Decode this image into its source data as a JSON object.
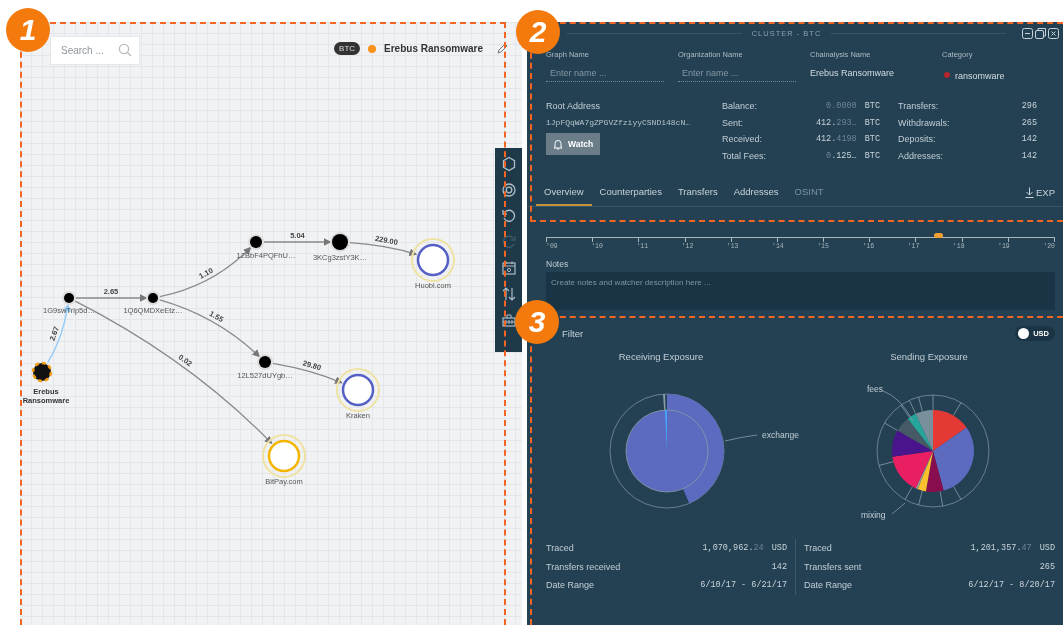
{
  "annotations": [
    {
      "number": "1"
    },
    {
      "number": "2"
    },
    {
      "number": "3"
    }
  ],
  "graph": {
    "search": {
      "placeholder": "Search ..."
    },
    "currency": "BTC",
    "entity_name": "Erebus Ransomware",
    "nodes": [
      {
        "label": "Erebus Ransomware",
        "kind": "source"
      },
      {
        "label": "1G9swTrip5d…",
        "kind": "address"
      },
      {
        "label": "1Q6QMDXeEtz…",
        "kind": "address"
      },
      {
        "label": "12BbF4PQFhU…",
        "kind": "address"
      },
      {
        "label": "3KCg3zstY3K…",
        "kind": "address"
      },
      {
        "label": "Huobi.com",
        "kind": "exchange"
      },
      {
        "label": "12L527dUYgb…",
        "kind": "address"
      },
      {
        "label": "Kraken",
        "kind": "exchange"
      },
      {
        "label": "BitPay.com",
        "kind": "merchant"
      }
    ],
    "edges": [
      {
        "label": "2.67",
        "kind": "direct"
      },
      {
        "label": "2.65",
        "kind": "transfer"
      },
      {
        "label": "1.10",
        "kind": "transfer"
      },
      {
        "label": "5.04",
        "kind": "transfer"
      },
      {
        "label": "229.00",
        "kind": "transfer"
      },
      {
        "label": "1.55",
        "kind": "transfer"
      },
      {
        "label": "29.80",
        "kind": "transfer"
      },
      {
        "label": "0.02",
        "kind": "transfer"
      }
    ],
    "tools": [
      {
        "kind": "hexagon",
        "disabled": false
      },
      {
        "kind": "target",
        "disabled": false
      },
      {
        "kind": "undo",
        "disabled": false
      },
      {
        "kind": "redo",
        "disabled": true
      },
      {
        "kind": "calendar",
        "disabled": false
      },
      {
        "kind": "swap",
        "disabled": false
      },
      {
        "kind": "toolbox",
        "disabled": false
      }
    ]
  },
  "panel": {
    "title": "CLUSTER - BTC",
    "fields": [
      {
        "label": "Graph Name",
        "kind": "input",
        "placeholder": "Enter name ..."
      },
      {
        "label": "Organization Name",
        "kind": "input",
        "placeholder": "Enter name ..."
      },
      {
        "label": "Chainalysis Name",
        "kind": "text",
        "value": "Erebus Ransomware"
      },
      {
        "label": "Category",
        "kind": "tag",
        "value": "ransomware",
        "color": "#b3262e"
      }
    ],
    "root": {
      "label": "Root Address",
      "value": "1JpFQqWA7gZPGVZfziyyCSND148cN…",
      "button": "Watch"
    },
    "balances": [
      {
        "label": "Balance:",
        "parts": [
          {
            "text": "0.0000",
            "dim": true
          }
        ],
        "unit": "BTC"
      },
      {
        "label": "Sent:",
        "parts": [
          {
            "text": "412.",
            "dim": false
          },
          {
            "text": "293…",
            "dim": true
          }
        ],
        "unit": "BTC"
      },
      {
        "label": "Received:",
        "parts": [
          {
            "text": "412.",
            "dim": false
          },
          {
            "text": "4198",
            "dim": true
          }
        ],
        "unit": "BTC"
      },
      {
        "label": "Total Fees:",
        "parts": [
          {
            "text": "0",
            "dim": true
          },
          {
            "text": ".125…",
            "dim": false
          }
        ],
        "unit": "BTC"
      }
    ],
    "counts": [
      {
        "label": "Transfers:",
        "value": "296"
      },
      {
        "label": "Withdrawals:",
        "value": "265"
      },
      {
        "label": "Deposits:",
        "value": "142"
      },
      {
        "label": "Addresses:",
        "value": "142"
      }
    ],
    "tabs": [
      {
        "label": "Overview",
        "selected": true,
        "disabled": false
      },
      {
        "label": "Counterparties",
        "selected": false,
        "disabled": false
      },
      {
        "label": "Transfers",
        "selected": false,
        "disabled": false
      },
      {
        "label": "Addresses",
        "selected": false,
        "disabled": false
      },
      {
        "label": "OSINT",
        "selected": false,
        "disabled": true
      }
    ],
    "export": "EXP",
    "timeline": {
      "ticks": [
        "'09",
        "'10",
        "'11",
        "'12",
        "'13",
        "'14",
        "'15",
        "'16",
        "'17",
        "'18",
        "'19",
        "'20"
      ],
      "level": 0.77
    },
    "notes": {
      "label": "Notes",
      "placeholder": "Create notes and watcher description here ..."
    },
    "filter": {
      "label": "Filter",
      "toggle": {
        "label": "USD",
        "on": false
      }
    },
    "exposure": [
      {
        "title": "Receiving Exposure",
        "kind": "receiving",
        "callouts": [
          "exchange"
        ],
        "rows": [
          {
            "label": "Traced",
            "parts": [
              {
                "text": "1,070,962.",
                "dim": false
              },
              {
                "text": "24",
                "dim": true
              }
            ],
            "unit": "USD"
          },
          {
            "label": "Transfers received",
            "parts": [
              {
                "text": "142",
                "dim": false
              }
            ]
          },
          {
            "label": "Date Range",
            "parts": [
              {
                "text": "6/10/17 - 6/21/17",
                "dim": false
              }
            ]
          }
        ]
      },
      {
        "title": "Sending Exposure",
        "kind": "sending",
        "callouts": [
          "fees",
          "mixing"
        ],
        "rows": [
          {
            "label": "Traced",
            "parts": [
              {
                "text": "1,201,357.",
                "dim": false
              },
              {
                "text": "47",
                "dim": true
              }
            ],
            "unit": "USD"
          },
          {
            "label": "Transfers sent",
            "parts": [
              {
                "text": "265",
                "dim": false
              }
            ]
          },
          {
            "label": "Date Range",
            "parts": [
              {
                "text": "6/12/17 - 8/20/17",
                "dim": false
              }
            ]
          }
        ]
      }
    ]
  }
}
